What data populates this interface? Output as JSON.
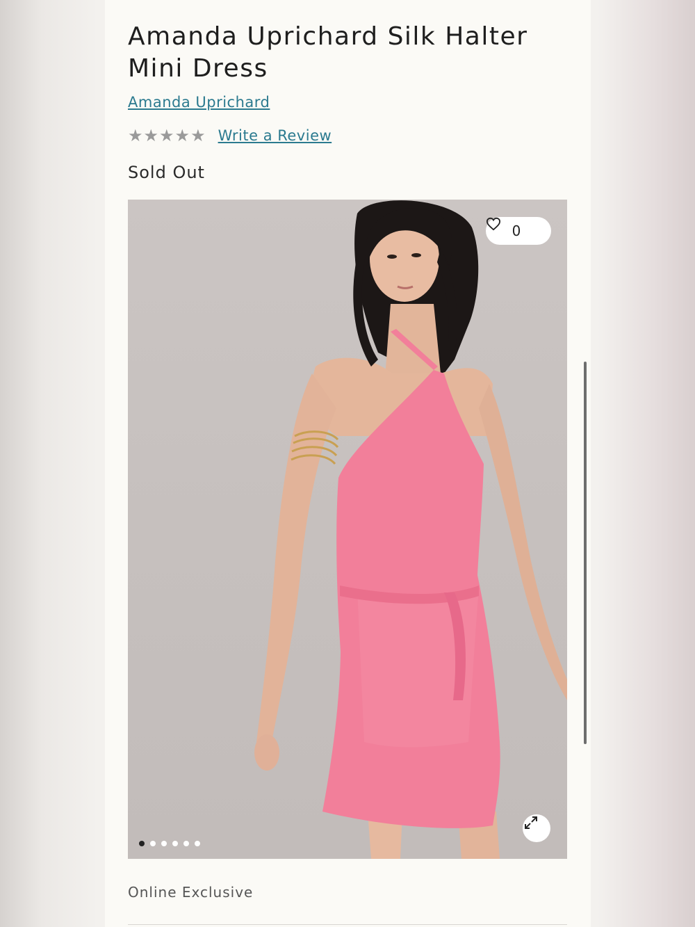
{
  "product": {
    "title": "Amanda Uprichard Silk Halter Mini Dress",
    "brand": "Amanda Uprichard",
    "rating_stars": 5,
    "rating_value": 0,
    "review_link": "Write a Review",
    "status": "Sold Out",
    "online_exclusive": "Online Exclusive"
  },
  "gallery": {
    "favorites_count": "0",
    "favorite_icon": "heart-icon",
    "expand_icon": "expand-icon",
    "image_count": 6,
    "active_image": 1,
    "colors": {
      "dress": "#f27f9a",
      "background": "#c8c2c0"
    }
  },
  "colors": {
    "link": "#2b7a8f",
    "star": "#9a9a9a"
  }
}
